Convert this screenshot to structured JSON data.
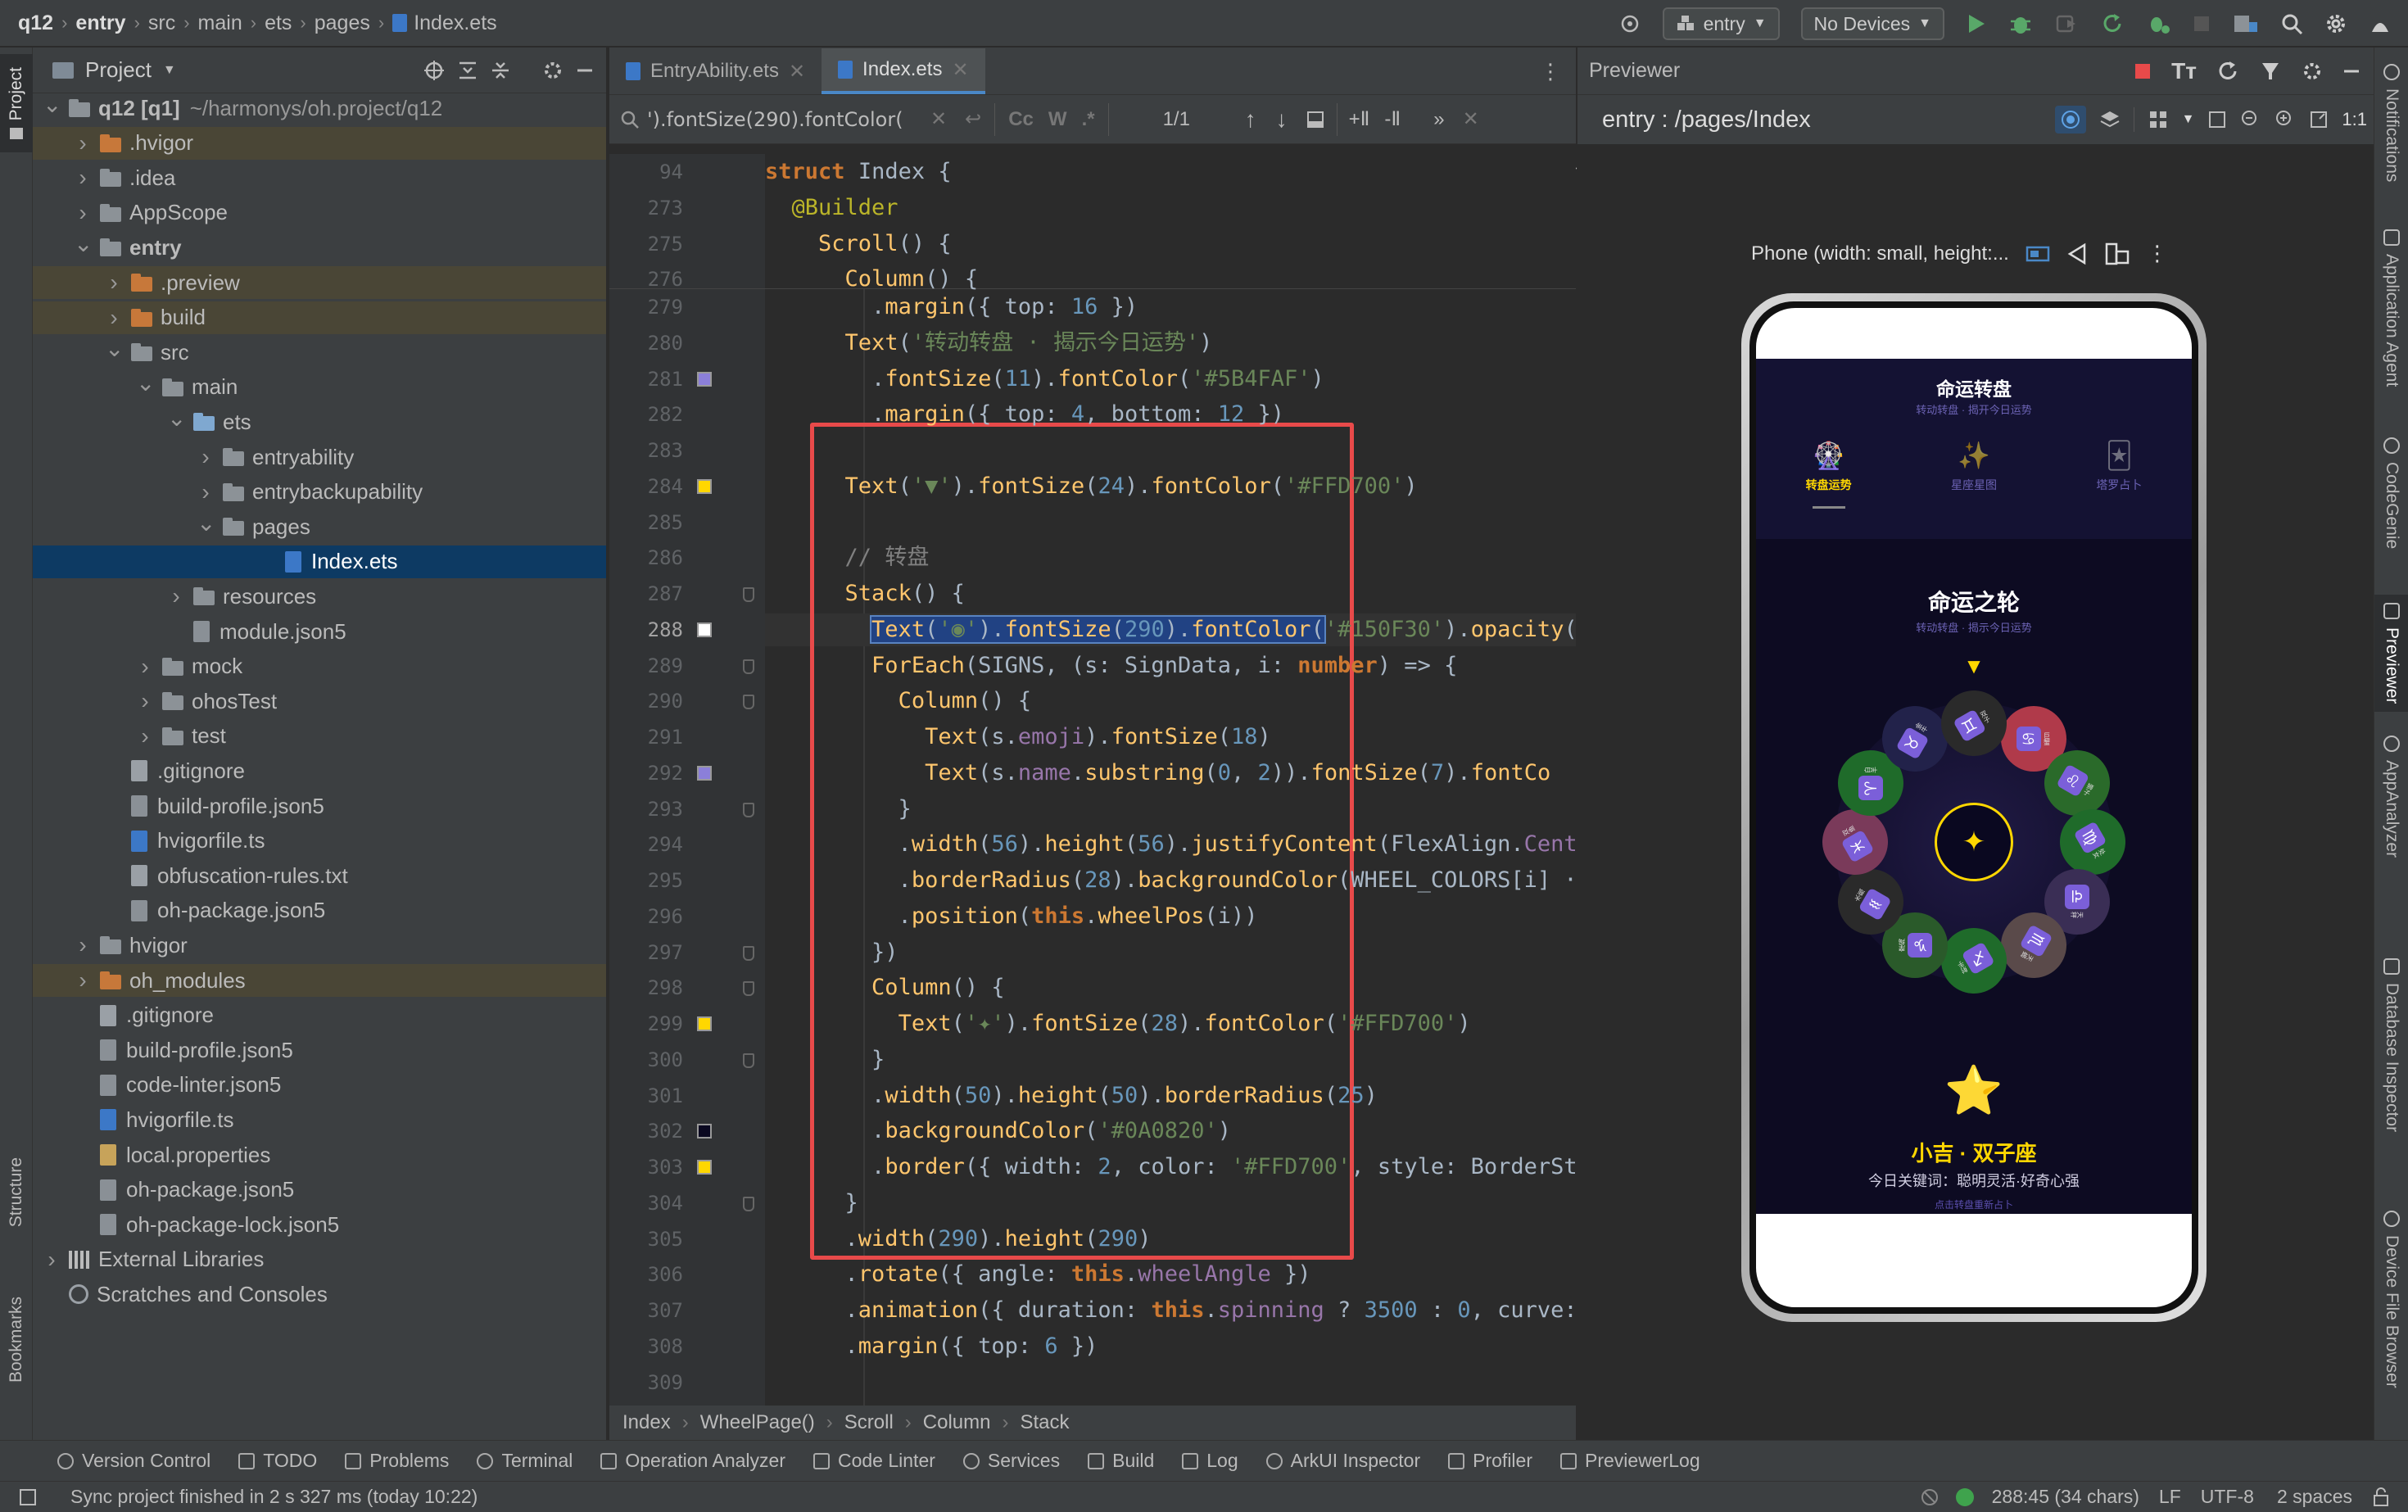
{
  "breadcrumb": [
    "q12",
    "entry",
    "src",
    "main",
    "ets",
    "pages",
    "Index.ets"
  ],
  "toolbar": {
    "run_config": "entry",
    "device": "No Devices"
  },
  "project_panel": {
    "title": "Project",
    "tree": [
      {
        "label": "q12 [q1]",
        "extra": "~/harmonys/oh.project/q12",
        "depth": 0,
        "arrow": "open",
        "icon": "folder-gray",
        "bold": true
      },
      {
        "label": ".hvigor",
        "depth": 1,
        "arrow": "closed",
        "icon": "folder-orange",
        "hl": "olive"
      },
      {
        "label": ".idea",
        "depth": 1,
        "arrow": "closed",
        "icon": "folder-gray"
      },
      {
        "label": "AppScope",
        "depth": 1,
        "arrow": "closed",
        "icon": "folder-gray"
      },
      {
        "label": "entry",
        "depth": 1,
        "arrow": "open",
        "icon": "folder-gray",
        "bold": true
      },
      {
        "label": ".preview",
        "depth": 2,
        "arrow": "closed",
        "icon": "folder-orange",
        "hl": "olive"
      },
      {
        "label": "build",
        "depth": 2,
        "arrow": "closed",
        "icon": "folder-orange",
        "hl": "olive"
      },
      {
        "label": "src",
        "depth": 2,
        "arrow": "open",
        "icon": "folder-gray"
      },
      {
        "label": "main",
        "depth": 3,
        "arrow": "open",
        "icon": "folder-gray"
      },
      {
        "label": "ets",
        "depth": 4,
        "arrow": "open",
        "icon": "folder-blue"
      },
      {
        "label": "entryability",
        "depth": 5,
        "arrow": "closed",
        "icon": "folder-gray"
      },
      {
        "label": "entrybackupability",
        "depth": 5,
        "arrow": "closed",
        "icon": "folder-gray"
      },
      {
        "label": "pages",
        "depth": 5,
        "arrow": "open",
        "icon": "folder-gray"
      },
      {
        "label": "Index.ets",
        "depth": 7,
        "arrow": "none",
        "icon": "file-ets",
        "hl": "sel"
      },
      {
        "label": "resources",
        "depth": 4,
        "arrow": "closed",
        "icon": "folder-gray"
      },
      {
        "label": "module.json5",
        "depth": 4,
        "arrow": "none",
        "icon": "file-gear"
      },
      {
        "label": "mock",
        "depth": 3,
        "arrow": "closed",
        "icon": "folder-gray"
      },
      {
        "label": "ohosTest",
        "depth": 3,
        "arrow": "closed",
        "icon": "folder-gray"
      },
      {
        "label": "test",
        "depth": 3,
        "arrow": "closed",
        "icon": "folder-gray"
      },
      {
        "label": ".gitignore",
        "depth": 2,
        "arrow": "none",
        "icon": "file"
      },
      {
        "label": "build-profile.json5",
        "depth": 2,
        "arrow": "none",
        "icon": "file-gear"
      },
      {
        "label": "hvigorfile.ts",
        "depth": 2,
        "arrow": "none",
        "icon": "file-ts"
      },
      {
        "label": "obfuscation-rules.txt",
        "depth": 2,
        "arrow": "none",
        "icon": "file"
      },
      {
        "label": "oh-package.json5",
        "depth": 2,
        "arrow": "none",
        "icon": "file-gear"
      },
      {
        "label": "hvigor",
        "depth": 1,
        "arrow": "closed",
        "icon": "folder-gray"
      },
      {
        "label": "oh_modules",
        "depth": 1,
        "arrow": "closed",
        "icon": "folder-orange",
        "hl": "olive"
      },
      {
        "label": ".gitignore",
        "depth": 1,
        "arrow": "none",
        "icon": "file"
      },
      {
        "label": "build-profile.json5",
        "depth": 1,
        "arrow": "none",
        "icon": "file-gear"
      },
      {
        "label": "code-linter.json5",
        "depth": 1,
        "arrow": "none",
        "icon": "file-gear"
      },
      {
        "label": "hvigorfile.ts",
        "depth": 1,
        "arrow": "none",
        "icon": "file-ts"
      },
      {
        "label": "local.properties",
        "depth": 1,
        "arrow": "none",
        "icon": "file-chart"
      },
      {
        "label": "oh-package.json5",
        "depth": 1,
        "arrow": "none",
        "icon": "file-gear"
      },
      {
        "label": "oh-package-lock.json5",
        "depth": 1,
        "arrow": "none",
        "icon": "file-gear"
      },
      {
        "label": "External Libraries",
        "depth": 0,
        "arrow": "closed",
        "icon": "libs"
      },
      {
        "label": "Scratches and Consoles",
        "depth": 0,
        "arrow": "none",
        "icon": "scratch"
      }
    ]
  },
  "left_stripe": {
    "project": "Project",
    "structure": "Structure",
    "bookmarks": "Bookmarks"
  },
  "right_stripe": [
    "Notifications",
    "Application Agent",
    "CodeGenie",
    "Previewer",
    "AppAnalyzer",
    "Database Inspector",
    "Device File Browser"
  ],
  "editor": {
    "tabs": [
      "EntryAbility.ets",
      "Index.ets"
    ],
    "find": {
      "query": "').fontSize(290).fontColor(",
      "count": "1/1",
      "opt_case": "Cc",
      "opt_word": "W",
      "opt_regex": ".*"
    },
    "warnings": "1",
    "sticky": [
      {
        "ln": "94",
        "code": "<span class='k'>struct</span> <span class='ty' style='color:#a9b7c6'>Index</span> {"
      },
      {
        "ln": "273",
        "code": "  <span class='an'>@Builder</span>"
      },
      {
        "ln": "275",
        "code": "    <span class='fn'>Scroll</span>() {"
      },
      {
        "ln": "276",
        "code": "      <span class='fn'>Column</span>() {"
      }
    ],
    "lines": [
      {
        "ln": "279",
        "code": "        .<span class='fn'>margin</span>({ top: <span class='n'>16</span> })"
      },
      {
        "ln": "280",
        "code": "      <span class='fn'>Text</span>(<span class='s'>'转动转盘 · 揭示今日运势'</span>)"
      },
      {
        "ln": "281",
        "code": "        .<span class='fn'>fontSize</span>(<span class='n'>11</span>).<span class='fn'>fontColor</span>(<span class='s'>'#5B4FAF'</span>)",
        "mark": "#8b7fd9"
      },
      {
        "ln": "282",
        "code": "        .<span class='fn'>margin</span>({ top: <span class='n'>4</span>, bottom: <span class='n'>12</span> })"
      },
      {
        "ln": "283",
        "code": ""
      },
      {
        "ln": "284",
        "code": "      <span class='fn'>Text</span>(<span class='s'>'▼'</span>).<span class='fn'>fontSize</span>(<span class='n'>24</span>).<span class='fn'>fontColor</span>(<span class='s'>'#FFD700'</span>)",
        "mark": "#ffd700"
      },
      {
        "ln": "285",
        "code": ""
      },
      {
        "ln": "286",
        "code": "      <span class='cm'>// 转盘</span>"
      },
      {
        "ln": "287",
        "code": "      <span class='fn'>Stack</span>() {"
      },
      {
        "ln": "288",
        "code": "        <span style='background:#214283;outline:2px solid #5983c0'><span class='fn'>Text</span>(<span class='s'>'◉'</span>).<span class='fn'>fontSize</span>(<span class='n'>290</span>).<span class='fn'>fontColor</span>(</span><span class='s'>'#150F30'</span>).<span class='fn'>opacity</span>(",
        "mark": "#ffffff",
        "current": true
      },
      {
        "ln": "289",
        "code": "        <span class='fn'>ForEach</span>(SIGNS, (s: <span class='ty'>SignData</span>, i: <span class='k'>number</span>) => {"
      },
      {
        "ln": "290",
        "code": "          <span class='fn'>Column</span>() {"
      },
      {
        "ln": "291",
        "code": "            <span class='fn'>Text</span>(s.<span class='p'>emoji</span>).<span class='fn'>fontSize</span>(<span class='n'>18</span>)"
      },
      {
        "ln": "292",
        "code": "            <span class='fn'>Text</span>(s.<span class='p'>name</span>.<span class='fn'>substring</span>(<span class='n'>0</span>, <span class='n'>2</span>)).<span class='fn'>fontSize</span>(<span class='n'>7</span>).<span class='fn'>fontCo</span>",
        "mark": "#8b7fd9"
      },
      {
        "ln": "293",
        "code": "          }"
      },
      {
        "ln": "294",
        "code": "          .<span class='fn'>width</span>(<span class='n'>56</span>).<span class='fn'>height</span>(<span class='n'>56</span>).<span class='fn'>justifyContent</span>(FlexAlign.<span class='p'>Cent</span>"
      },
      {
        "ln": "295",
        "code": "          .<span class='fn'>borderRadius</span>(<span class='n'>28</span>).<span class='fn'>backgroundColor</span>(WHEEL_COLORS[i] ·"
      },
      {
        "ln": "296",
        "code": "          .<span class='fn'>position</span>(<span class='k'>this</span>.<span class='fn'>wheelPos</span>(i))"
      },
      {
        "ln": "297",
        "code": "        })"
      },
      {
        "ln": "298",
        "code": "        <span class='fn'>Column</span>() {"
      },
      {
        "ln": "299",
        "code": "          <span class='fn'>Text</span>(<span class='s'>'✦'</span>).<span class='fn'>fontSize</span>(<span class='n'>28</span>).<span class='fn'>fontColor</span>(<span class='s'>'#FFD700'</span>)",
        "mark": "#ffd700"
      },
      {
        "ln": "300",
        "code": "        }"
      },
      {
        "ln": "301",
        "code": "        .<span class='fn'>width</span>(<span class='n'>50</span>).<span class='fn'>height</span>(<span class='n'>50</span>).<span class='fn'>borderRadius</span>(<span class='n'>25</span>)"
      },
      {
        "ln": "302",
        "code": "        .<span class='fn'>backgroundColor</span>(<span class='s'>'#0A0820'</span>)",
        "mark": "#0a0820"
      },
      {
        "ln": "303",
        "code": "        .<span class='fn'>border</span>({ width: <span class='n'>2</span>, color: <span class='s'>'#FFD700'</span>, style: BorderSt",
        "mark": "#ffd700"
      },
      {
        "ln": "304",
        "code": "      }"
      },
      {
        "ln": "305",
        "code": "      .<span class='fn'>width</span>(<span class='n'>290</span>).<span class='fn'>height</span>(<span class='n'>290</span>)"
      },
      {
        "ln": "306",
        "code": "      .<span class='fn'>rotate</span>({ angle: <span class='k'>this</span>.<span class='p'>wheelAngle</span> })"
      },
      {
        "ln": "307",
        "code": "      .<span class='fn'>animation</span>({ duration: <span class='k'>this</span>.<span class='p'>spinning</span> ? <span class='n'>3500</span> : <span class='n'>0</span>, curve:"
      },
      {
        "ln": "308",
        "code": "      .<span class='fn'>margin</span>({ top: <span class='n'>6</span> })"
      },
      {
        "ln": "309",
        "code": ""
      }
    ],
    "breadcrumbs": [
      "Index",
      "WheelPage()",
      "Scroll",
      "Column",
      "Stack"
    ]
  },
  "previewer": {
    "title": "Previewer",
    "route": "entry : /pages/Index",
    "device_label": "Phone (width: small, height:...",
    "app": {
      "title": "命运转盘",
      "subtitle": "转动转盘 · 揭开今日运势",
      "tabs": [
        {
          "icon": "🎡",
          "label": "转盘运势",
          "active": true
        },
        {
          "icon": "✨",
          "label": "星座星图",
          "active": false
        },
        {
          "icon": "🃏",
          "label": "塔罗占卜",
          "active": false
        }
      ],
      "wheel_title": "命运之轮",
      "wheel_subtitle": "转动转盘 · 揭示今日运势",
      "pointer": "▼",
      "center_star": "✦",
      "signs": [
        {
          "glyph": "♋",
          "name": "巨蟹",
          "color": "#b03a4a"
        },
        {
          "glyph": "♌",
          "name": "狮子",
          "color": "#2a6a2a"
        },
        {
          "glyph": "♍",
          "name": "处女",
          "color": "#1f6b2a"
        },
        {
          "glyph": "♎",
          "name": "天秤",
          "color": "#3a2e55"
        },
        {
          "glyph": "♏",
          "name": "天蝎",
          "color": "#5a4a4a"
        },
        {
          "glyph": "♐",
          "name": "射手",
          "color": "#1f6b2a"
        },
        {
          "glyph": "♑",
          "name": "摩羯",
          "color": "#2a5a2a"
        },
        {
          "glyph": "♒",
          "name": "水瓶",
          "color": "#2a2a2a"
        },
        {
          "glyph": "♓",
          "name": "双鱼",
          "color": "#7a3a5a"
        },
        {
          "glyph": "♈",
          "name": "白羊",
          "color": "#1f6b2a"
        },
        {
          "glyph": "♉",
          "name": "金牛",
          "color": "#22224a"
        },
        {
          "glyph": "♊",
          "name": "双子",
          "color": "#2a2a2a"
        }
      ],
      "result_icon": "⭐",
      "result_title": "小吉 · 双子座",
      "result_keywords": "今日关键词：聪明灵活·好奇心强",
      "result_hint": "点击转盘重新占卜"
    }
  },
  "bottom_tools": [
    "Version Control",
    "TODO",
    "Problems",
    "Terminal",
    "Operation Analyzer",
    "Code Linter",
    "Services",
    "Build",
    "Log",
    "ArkUI Inspector",
    "Profiler",
    "PreviewerLog"
  ],
  "status": {
    "message": "Sync project finished in 2 s 327 ms (today 10:22)",
    "position": "288:45 (34 chars)",
    "line_ending": "LF",
    "encoding": "UTF-8",
    "indent": "2 spaces"
  }
}
